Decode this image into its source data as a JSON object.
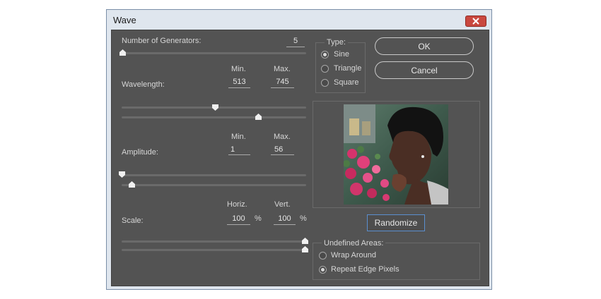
{
  "window": {
    "title": "Wave"
  },
  "generators": {
    "label": "Number of Generators:",
    "value": "5",
    "level": 0.0
  },
  "wavelength": {
    "label": "Wavelength:",
    "min_header": "Min.",
    "max_header": "Max.",
    "min": "513",
    "max": "745"
  },
  "amplitude": {
    "label": "Amplitude:",
    "min_header": "Min.",
    "max_header": "Max.",
    "min": "1",
    "max": "56"
  },
  "scale": {
    "label": "Scale:",
    "horiz_header": "Horiz.",
    "vert_header": "Vert.",
    "horiz": "100",
    "vert": "100",
    "unit": "%"
  },
  "type": {
    "legend": "Type:",
    "options": [
      "Sine",
      "Triangle",
      "Square"
    ],
    "selected": "Sine"
  },
  "buttons": {
    "ok": "OK",
    "cancel": "Cancel",
    "randomize": "Randomize"
  },
  "undefined_areas": {
    "legend": "Undefined Areas:",
    "options": [
      "Wrap Around",
      "Repeat Edge Pixels"
    ],
    "selected": "Repeat Edge Pixels"
  },
  "colors": {
    "panel": "#535353",
    "chrome": "#dfe6ee",
    "close": "#c9483f",
    "focus": "#5b8fcf"
  },
  "icons": {
    "close": "close-icon"
  }
}
